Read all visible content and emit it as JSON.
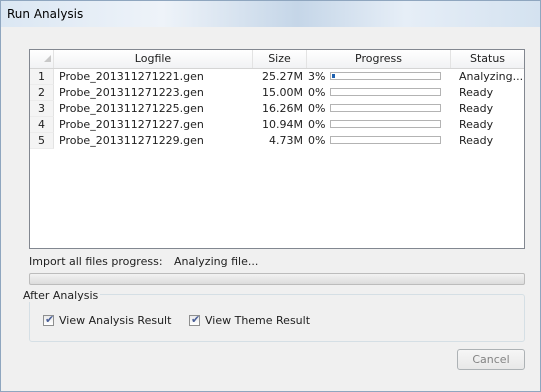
{
  "window": {
    "title": "Run Analysis"
  },
  "table": {
    "headers": {
      "logfile": "Logfile",
      "size": "Size",
      "progress": "Progress",
      "status": "Status"
    },
    "rows": [
      {
        "num": "1",
        "logfile": "Probe_201311271221.gen",
        "size": "25.27M",
        "percent": "3%",
        "progress": 0.03,
        "status": "Analyzing..."
      },
      {
        "num": "2",
        "logfile": "Probe_201311271223.gen",
        "size": "15.00M",
        "percent": "0%",
        "progress": 0.0,
        "status": "Ready"
      },
      {
        "num": "3",
        "logfile": "Probe_201311271225.gen",
        "size": "16.26M",
        "percent": "0%",
        "progress": 0.0,
        "status": "Ready"
      },
      {
        "num": "4",
        "logfile": "Probe_201311271227.gen",
        "size": "10.94M",
        "percent": "0%",
        "progress": 0.0,
        "status": "Ready"
      },
      {
        "num": "5",
        "logfile": "Probe_201311271229.gen",
        "size": "4.73M",
        "percent": "0%",
        "progress": 0.0,
        "status": "Ready"
      }
    ]
  },
  "import": {
    "label": "Import all files progress:",
    "status": "Analyzing file...",
    "progress": 0.0
  },
  "after_analysis": {
    "title": "After Analysis",
    "view_analysis_result": {
      "label": "View Analysis Result",
      "checked": true
    },
    "view_theme_result": {
      "label": "View Theme Result",
      "checked": true
    }
  },
  "buttons": {
    "cancel": "Cancel"
  },
  "colors": {
    "progress_fill": "#1e61b0",
    "accent": "#4a5f97"
  }
}
